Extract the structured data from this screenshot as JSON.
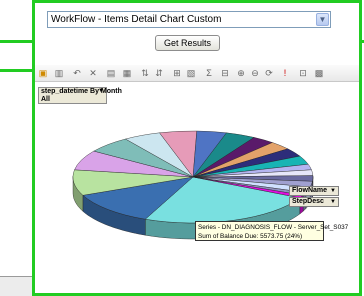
{
  "report_select": {
    "value": "WorkFlow - Items Detail Chart Custom"
  },
  "get_results": {
    "label": "Get Results"
  },
  "filter": {
    "label": "step_datetime By Month",
    "value": "All"
  },
  "fields": {
    "flowname": "FlowName",
    "stepdesc": "StepDesc"
  },
  "tooltip": {
    "line1": "Series - DN_DIAGNOSIS_FLOW - Server_Set_S037",
    "line2": "Sum of Balance Due: 5573.75 (24%)"
  },
  "toolbar_icons": [
    "chart-wizard-icon",
    "chart-type-icon",
    "undo-icon",
    "delete-icon",
    "property-icon",
    "field-list-icon",
    "sort-ascending-icon",
    "sort-descending-icon",
    "autofilter-icon",
    "show-top-icon",
    "subtotal-icon",
    "calculated-total-icon",
    "expand-icon",
    "collapse-icon",
    "refresh-icon",
    "export-icon",
    "help-icon",
    "commands-icon"
  ],
  "chart_data": {
    "type": "pie",
    "values": [
      24,
      12,
      9,
      7,
      6,
      5,
      5,
      4,
      4,
      3,
      3,
      3,
      3,
      2,
      2,
      2,
      2,
      2,
      1,
      1
    ],
    "colors": [
      "#79e0e0",
      "#3a6fb0",
      "#b8e3a0",
      "#d9a3e8",
      "#7fbdb8",
      "#cce6f0",
      "#e69bb8",
      "#4f74c4",
      "#1a8a8a",
      "#5a1a6a",
      "#e3a26a",
      "#2d2d7a",
      "#18b4b4",
      "#b4b4f0",
      "#e6e6fa",
      "#6a6aa0",
      "#a0a0d0",
      "#d0e0ff",
      "#9090c0",
      "#e00ee0"
    ]
  }
}
